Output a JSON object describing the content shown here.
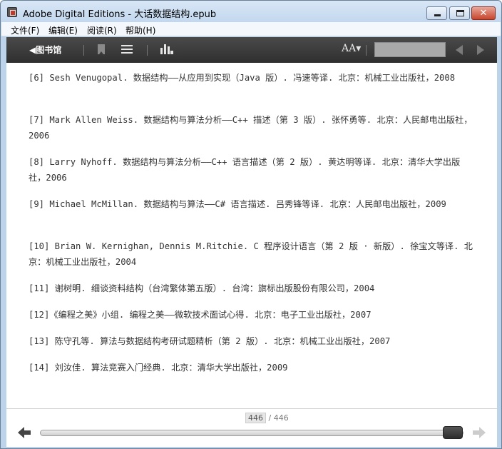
{
  "window": {
    "title": "Adobe Digital Editions - 大话数据结构.epub",
    "close_glyph": "✕"
  },
  "menu": [
    {
      "label": "文件(F)"
    },
    {
      "label": "编辑(E)"
    },
    {
      "label": "阅读(R)"
    },
    {
      "label": "帮助(H)"
    }
  ],
  "toolbar": {
    "library_label": "◀图书馆",
    "font_size_label": "AA▾",
    "search_value": ""
  },
  "references": [
    "[6] Sesh Venugopal. 数据结构——从应用到实现（Java 版）. 冯速等译. 北京：机械工业出版社，2008",
    "[7] Mark Allen Weiss. 数据结构与算法分析——C++ 描述（第 3 版）. 张怀勇等. 北京：人民邮电出版社，2006",
    "[8] Larry Nyhoff. 数据结构与算法分析——C++ 语言描述（第 2 版）. 黄达明等译. 北京：清华大学出版社，2006",
    "[9] Michael McMillan. 数据结构与算法——C# 语言描述. 吕秀锋等译. 北京：人民邮电出版社，2009",
    "[10] Brian W. Kernighan, Dennis M.Ritchie. C 程序设计语言（第 2 版 · 新版）. 徐宝文等译. 北京：机械工业出版社，2004",
    "[11] 谢树明. 细谈资料结构（台湾繁体第五版）. 台湾：旗标出版股份有限公司，2004",
    "[12]《编程之美》小组. 编程之美——微软技术面试心得. 北京：电子工业出版社，2007",
    "[13] 陈守孔等. 算法与数据结构考研试题精析（第 2 版）. 北京：机械工业出版社，2007",
    "[14] 刘汝佳. 算法竞赛入门经典. 北京：清华大学出版社，2009"
  ],
  "pagination": {
    "current": "446",
    "separator": "/",
    "total": "446",
    "progress": 1.0
  }
}
